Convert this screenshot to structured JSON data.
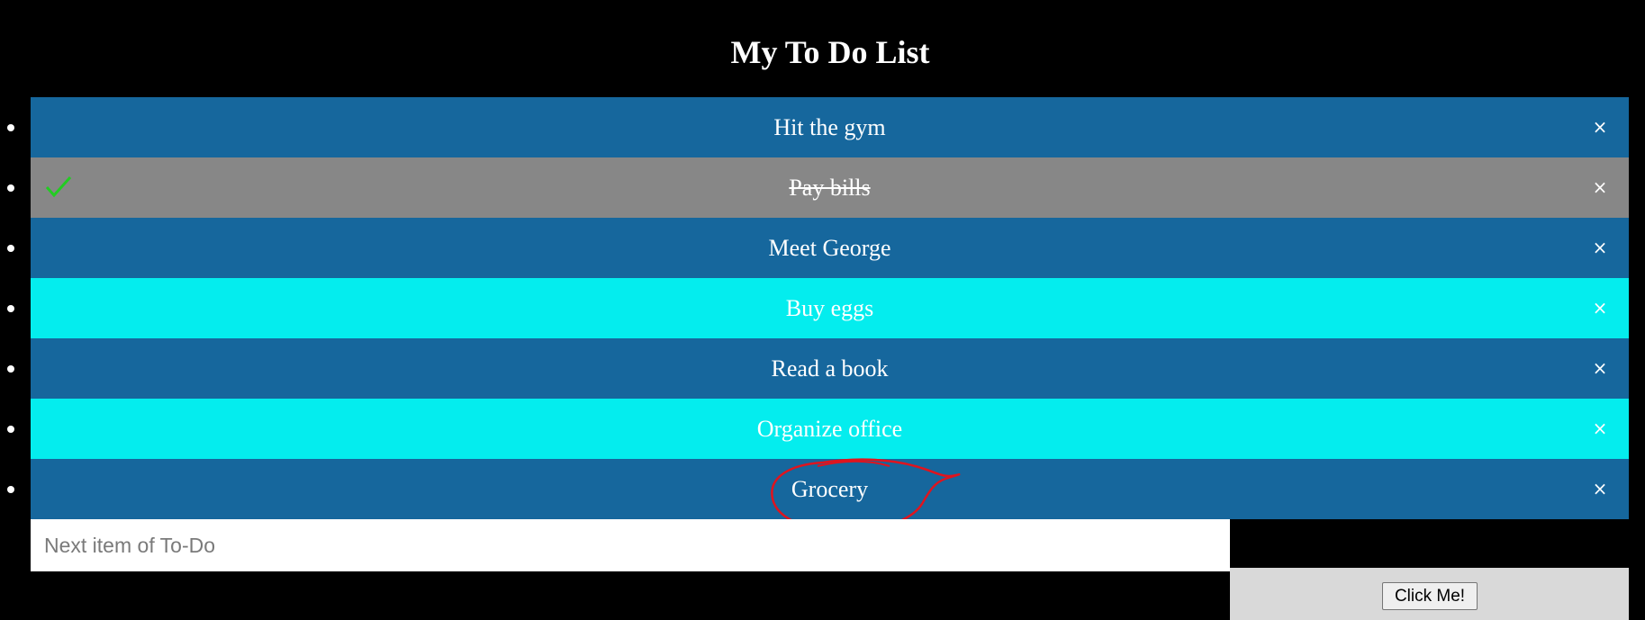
{
  "header": {
    "title": "My To Do List"
  },
  "todo": {
    "items": [
      {
        "text": "Hit the gym",
        "checked": false,
        "color": "#16679d",
        "close": "×"
      },
      {
        "text": "Pay bills",
        "checked": true,
        "color": "#878787",
        "close": "×"
      },
      {
        "text": "Meet George",
        "checked": false,
        "color": "#16679d",
        "close": "×"
      },
      {
        "text": "Buy eggs",
        "checked": false,
        "color": "#04edee",
        "close": "×"
      },
      {
        "text": "Read a book",
        "checked": false,
        "color": "#16679d",
        "close": "×"
      },
      {
        "text": "Organize office",
        "checked": false,
        "color": "#04edee",
        "close": "×"
      },
      {
        "text": "Grocery",
        "checked": false,
        "color": "#16679d",
        "close": "×"
      }
    ]
  },
  "input": {
    "placeholder": "Next item of To-Do",
    "value": ""
  },
  "button": {
    "label": "Click Me!"
  },
  "colors": {
    "background": "#000000",
    "check": "#22cc22",
    "annotation": "#e0141e"
  },
  "icons": {
    "check": "check-icon",
    "close": "close-icon"
  }
}
